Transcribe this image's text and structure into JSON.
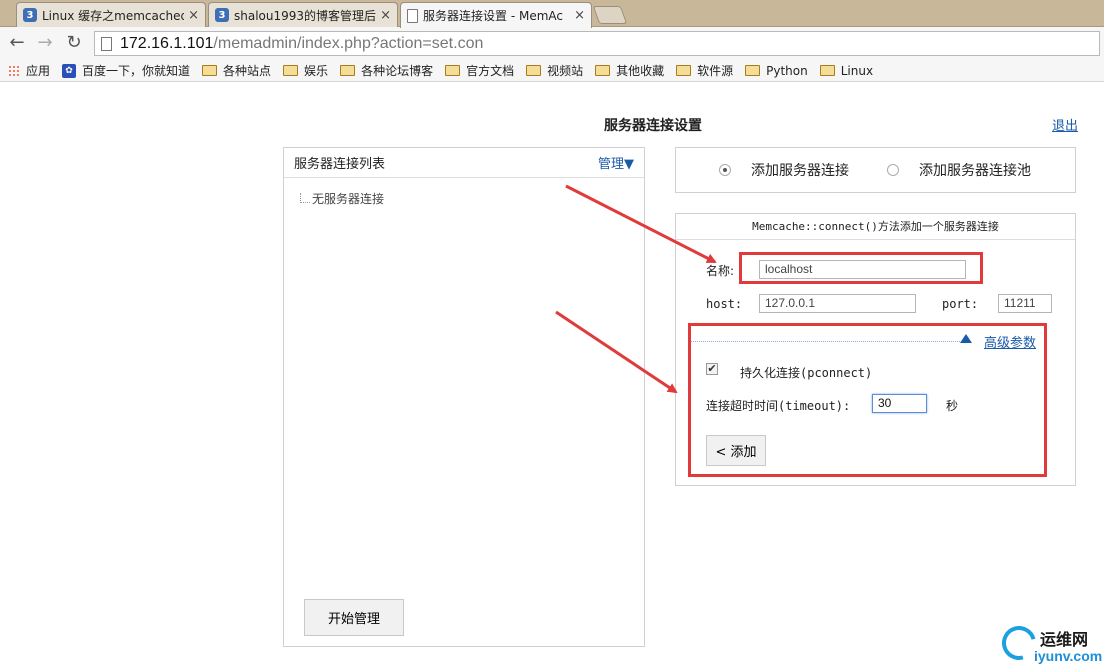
{
  "browser": {
    "tabs": [
      {
        "title": "Linux 缓存之memcached",
        "icon": "blue-3-icon",
        "close": "×"
      },
      {
        "title": "shalou1993的博客管理后",
        "icon": "blue-3-icon",
        "close": "×"
      },
      {
        "title": "服务器连接设置 - MemAc",
        "icon": "page-icon",
        "close": "×"
      }
    ],
    "url_host": "172.16.1.101",
    "url_path": "/memadmin/index.php?action=set.con",
    "bookmarks": [
      "应用",
      "百度一下，你就知道",
      "各种站点",
      "娱乐",
      "各种论坛博客",
      "官方文档",
      "视频站",
      "其他收藏",
      "软件源",
      "Python",
      "Linux"
    ]
  },
  "page": {
    "title": "服务器连接设置",
    "logout": "退出",
    "left": {
      "header": "服务器连接列表",
      "manage": "管理▼",
      "empty": "无服务器连接",
      "start_button": "开始管理"
    },
    "mode": {
      "option1": "添加服务器连接",
      "option2": "添加服务器连接池",
      "selected": "option1"
    },
    "form": {
      "header": "Memcache::connect()方法添加一个服务器连接",
      "name_label": "名称:",
      "name_value": "localhost",
      "host_label": "host:",
      "host_value": "127.0.0.1",
      "port_label": "port:",
      "port_value": "11211",
      "advanced_link": "高级参数",
      "pconnect_label": "持久化连接(pconnect)",
      "pconnect_checked": "✔",
      "timeout_label": "连接超时时间(timeout):",
      "timeout_value": "30",
      "timeout_unit": "秒",
      "add_button": "< 添加"
    }
  },
  "watermark": {
    "line1": "运维网",
    "line2": "iyunv.com"
  },
  "colors": {
    "link": "#1a5aa8",
    "highlight": "#e03a3a"
  }
}
